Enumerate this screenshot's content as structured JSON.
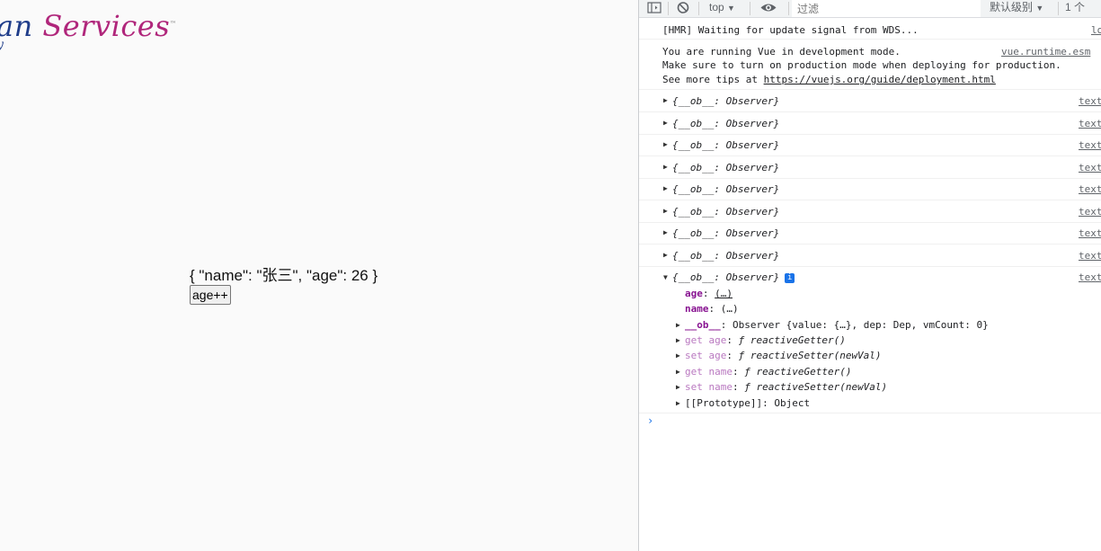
{
  "page": {
    "logo": {
      "part1": "an ",
      "part2": "Services",
      "trademark": "™",
      "line2": "y"
    },
    "json_text": "{ \"name\": \"张三\", \"age\": 26 }",
    "button_label": "age++"
  },
  "devtools": {
    "toolbar": {
      "context": "top",
      "filter_placeholder": "过滤",
      "levels": "默认级别",
      "issues": "1 个"
    },
    "logs": {
      "hmr": "[HMR] Waiting for update signal from WDS...",
      "hmr_source": "lo",
      "vue_line1": "You are running Vue in development mode.",
      "vue_line2": "Make sure to turn on production mode when deploying for production.",
      "vue_line3_prefix": "See more tips at ",
      "vue_line3_link": "https://vuejs.org/guide/deployment.html",
      "vue_source": "vue.runtime.esm",
      "observer_label": "{__ob__: Observer}",
      "observer_source": "text"
    },
    "expanded": {
      "age_key": "age",
      "age_val": "(…)",
      "name_key": "name",
      "name_val": "(…)",
      "ob_key": "__ob__",
      "ob_val": "Observer {value: {…}, dep: Dep, vmCount: 0}",
      "get_age_key": "get age",
      "get_age_val": "ƒ reactiveGetter()",
      "set_age_key": "set age",
      "set_age_val": "ƒ reactiveSetter(newVal)",
      "get_name_key": "get name",
      "get_name_val": "ƒ reactiveGetter()",
      "set_name_key": "set name",
      "set_name_val": "ƒ reactiveSetter(newVal)",
      "proto_key": "[[Prototype]]",
      "proto_val": "Object"
    }
  }
}
